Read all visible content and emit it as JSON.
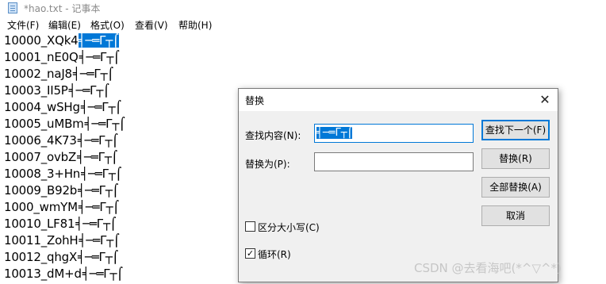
{
  "window": {
    "title": "*hao.txt - 记事本"
  },
  "menu": [
    {
      "label": "文件(F)"
    },
    {
      "label": "编辑(E)"
    },
    {
      "label": "格式(O)"
    },
    {
      "label": "查看(V)"
    },
    {
      "label": "帮助(H)"
    }
  ],
  "editor": {
    "lines": [
      {
        "prefix": "10000_XQk4",
        "suffix": "╡─═Γ┬⌠",
        "selected": true
      },
      {
        "prefix": "10001_nE0Q",
        "suffix": "╡─═Γ┬⌠"
      },
      {
        "prefix": "10002_naJ8",
        "suffix": "╡─═Γ┬⌠"
      },
      {
        "prefix": "10003_II5P",
        "suffix": "╡─═Γ┬⌠"
      },
      {
        "prefix": "10004_wSHg",
        "suffix": "╡─═Γ┬⌠"
      },
      {
        "prefix": "10005_uMBm",
        "suffix": "╡─═Γ┬⌠"
      },
      {
        "prefix": "10006_4K73",
        "suffix": "╡─═Γ┬⌠"
      },
      {
        "prefix": "10007_ovbZ",
        "suffix": "╡─═Γ┬⌠"
      },
      {
        "prefix": "10008_3+Hn",
        "suffix": "╡─═Γ┬⌠"
      },
      {
        "prefix": "10009_B92b",
        "suffix": "╡─═Γ┬⌠"
      },
      {
        "prefix": "1000_wmYM",
        "suffix": "╡─═Γ┬⌠"
      },
      {
        "prefix": "10010_LF81",
        "suffix": "╡─═Γ┬⌠"
      },
      {
        "prefix": "10011_ZohH",
        "suffix": "╡─═Γ┬⌠"
      },
      {
        "prefix": "10012_qhgX",
        "suffix": "╡─═Γ┬⌠"
      },
      {
        "prefix": "10013_dM+d",
        "suffix": "╡─═Γ┬⌠"
      }
    ]
  },
  "dialog": {
    "title": "替换",
    "close_glyph": "✕",
    "find_label": "查找内容(N):",
    "find_value": "╡─═Γ┬⌠",
    "replace_label": "替换为(P):",
    "replace_value": "",
    "buttons": {
      "find_next": "查找下一个(F)",
      "replace": "替换(R)",
      "replace_all": "全部替换(A)",
      "cancel": "取消"
    },
    "match_case": {
      "label": "区分大小写(C)",
      "checked": false
    },
    "wrap": {
      "label": "循环(R)",
      "checked": true,
      "mark": "✓"
    }
  },
  "watermark": "CSDN @去看海吧(*^▽^*)",
  "colors": {
    "selection": "#0078d7",
    "dialog_bg": "#f0f0f0",
    "button_bg": "#e1e1e1"
  }
}
